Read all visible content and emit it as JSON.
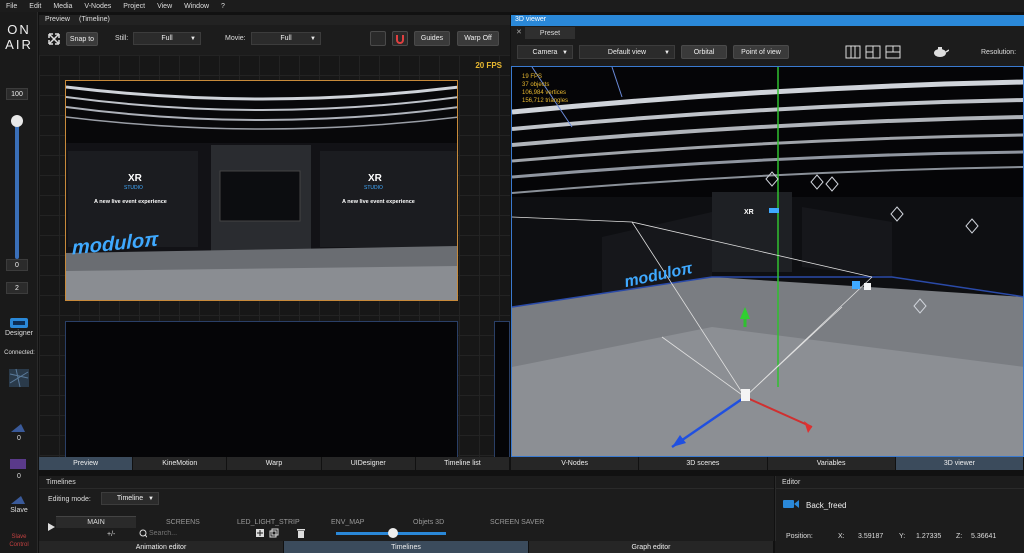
{
  "menu": [
    "File",
    "Edit",
    "Media",
    "V-Nodes",
    "Project",
    "View",
    "Window",
    "?"
  ],
  "onair": {
    "line1": "ON",
    "line2": "AIR"
  },
  "left_panel": {
    "values": [
      "100",
      "0",
      "2"
    ],
    "designer_label": "Designer",
    "connected_label": "Connected:",
    "counts": [
      "0",
      "0",
      "0"
    ],
    "slave_label": "Slave",
    "slave_control_label": "Slave Control"
  },
  "preview": {
    "title": "Preview",
    "subtitle": "(Timeline)",
    "snap_label": "Snap to",
    "still_label": "Still:",
    "still_value": "Full",
    "movie_label": "Movie:",
    "movie_value": "Full",
    "guides_label": "Guides",
    "warp_off_label": "Warp Off",
    "fps": "20 FPS",
    "tabs": [
      "Preview",
      "KineMotion",
      "Warp",
      "UIDesigner",
      "Timeline list"
    ],
    "active_tab": 0
  },
  "scene_text": {
    "xr": "XR",
    "studio": "STUDIO",
    "tagline": "A new live event experience",
    "brand": "moduloπ"
  },
  "viewer3d": {
    "title": "3D viewer",
    "preset_tab": "Preset",
    "camera_label": "Camera",
    "default_view_label": "Default view",
    "orbital_label": "Orbital",
    "pov_label": "Point of view",
    "resolution_label": "Resolution:",
    "stats": [
      "19 FPS",
      "37 objects",
      "106,984 vertices",
      "156,712 triangles"
    ],
    "tabs": [
      "V-Nodes",
      "3D scenes",
      "Variables",
      "3D viewer"
    ],
    "active_tab": 3
  },
  "timelines": {
    "title": "Timelines",
    "editing_mode_label": "Editing mode:",
    "editing_mode_value": "Timeline",
    "plusminus": "+/-",
    "search_placeholder": "Search...",
    "tracks": [
      "MAIN",
      "SCREENS",
      "LED_LIGHT_STRIP",
      "ENV_MAP",
      "Objets 3D",
      "SCREEN SAVER"
    ],
    "active_track": 0,
    "slider_value": 0.75
  },
  "editor": {
    "title": "Editor",
    "object_name": "Back_freed",
    "position_label": "Position:",
    "x_label": "X:",
    "x_value": "3.59187",
    "y_label": "Y:",
    "y_value": "1.27335",
    "z_label": "Z:",
    "z_value": "5.36641"
  },
  "bottom_tabs": [
    "Animation editor",
    "Timelines",
    "Graph editor"
  ],
  "bottom_active": 1,
  "colors": {
    "accent": "#2a88d8",
    "fps": "#e8b830",
    "brand": "#3fa9ff",
    "active_tab": "#3b4b5c"
  }
}
